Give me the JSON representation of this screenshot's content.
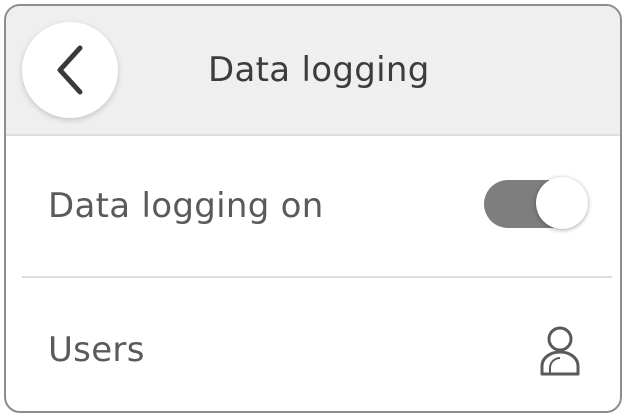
{
  "header": {
    "title": "Data logging",
    "back_icon": "chevron-left-icon"
  },
  "rows": [
    {
      "label": "Data logging on",
      "control": "toggle",
      "toggle_on": true
    },
    {
      "label": "Users",
      "icon": "user-icon"
    }
  ],
  "colors": {
    "header_bg": "#efefef",
    "toggle_track": "#7e7e7e",
    "text": "#5a5a5a",
    "border": "#8d8d8d"
  }
}
